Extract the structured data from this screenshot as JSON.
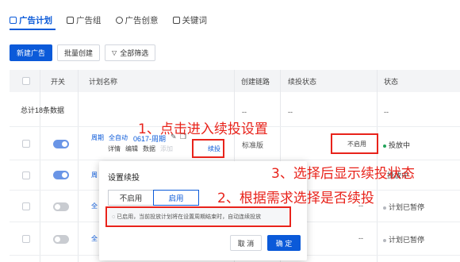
{
  "tabs": [
    {
      "label": "广告计划",
      "icon": "plan-icon"
    },
    {
      "label": "广告组",
      "icon": "group-icon"
    },
    {
      "label": "广告创意",
      "icon": "creative-icon"
    },
    {
      "label": "关键词",
      "icon": "keyword-icon"
    }
  ],
  "toolbar": {
    "new_ad": "新建广告",
    "batch_create": "批量创建",
    "filter_all": "全部筛选"
  },
  "table": {
    "headers": {
      "switch": "开关",
      "plan_name": "计划名称",
      "create_link": "创建链路",
      "renew_status": "续投状态",
      "status": "状态"
    },
    "summary": {
      "label": "总计18条数据",
      "create_link": "--",
      "renew_status": "--",
      "status": "--"
    },
    "row1": {
      "tag": "周期",
      "mode": "全自动",
      "name": "0617-周期",
      "actions": [
        "详情",
        "编辑",
        "数据",
        "添加"
      ],
      "renew_link": "续投",
      "create_link": "标准版",
      "renew_state": "不启用",
      "status": "投放中",
      "status_color": "#22a35a"
    },
    "row2": {
      "tag": "周",
      "status_partial": "投放中"
    },
    "row3": {
      "tag": "全",
      "renew_state": "--",
      "status": "计划已暂停",
      "status_color": "#b5b8be"
    },
    "row4": {
      "tag": "全",
      "renew_state": "--",
      "status": "计划已暂停",
      "status_color": "#b5b8be"
    }
  },
  "popup": {
    "title": "设置续投",
    "option_off": "不启用",
    "option_on": "启用",
    "notice": "已启用，当前投放计划将在设置周期结束时，自动连续投放",
    "cancel": "取 消",
    "confirm": "确 定"
  },
  "annotations": {
    "step1": "1、点击进入续投设置",
    "step2": "2、根据需求选择是否续投",
    "step3": "3、选择后显示续投状态"
  }
}
